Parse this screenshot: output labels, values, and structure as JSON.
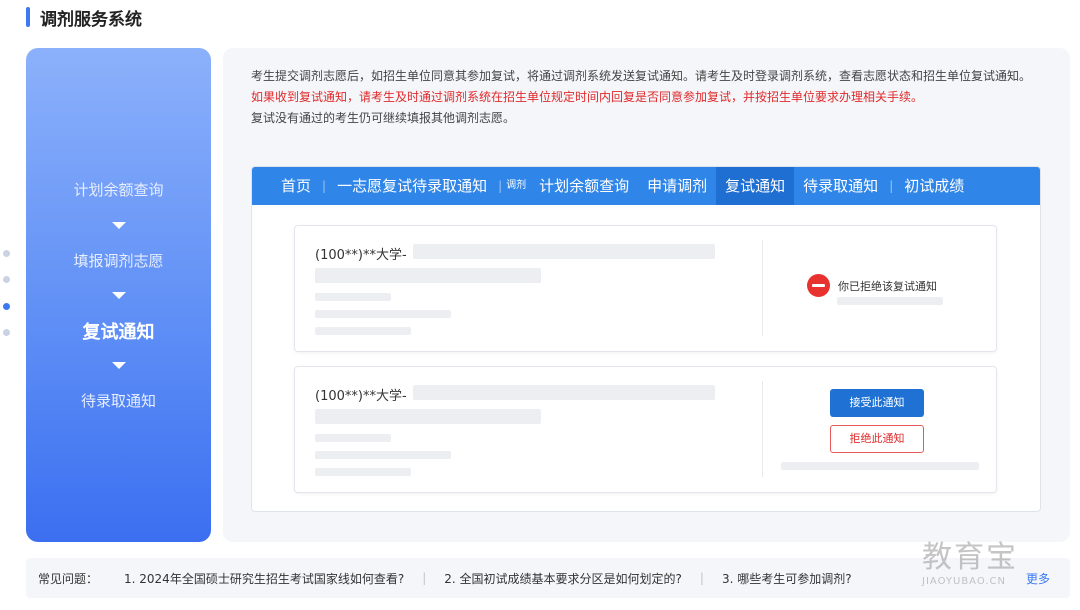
{
  "page_title": "调剂服务系统",
  "steps": [
    {
      "label": "计划余额查询",
      "active": false
    },
    {
      "label": "填报调剂志愿",
      "active": false
    },
    {
      "label": "复试通知",
      "active": true
    },
    {
      "label": "待录取通知",
      "active": false
    }
  ],
  "description": {
    "normal_1": "考生提交调剂志愿后，如招生单位同意其参加复试，将通过调剂系统发送复试通知。请考生及时登录调剂系统，查看志愿状态和招生单位复试通知。",
    "red": "如果收到复试通知，请考生及时通过调剂系统在招生单位规定时间内回复是否同意参加复试，并按招生单位要求办理相关手续。",
    "normal_2": "复试没有通过的考生仍可继续填报其他调剂志愿。"
  },
  "nav": {
    "home": "首页",
    "first_choice": "一志愿复试待录取通知",
    "adjust_small": "调剂",
    "plan_balance": "计划余额查询",
    "apply": "申请调剂",
    "retest_notice": "复试通知",
    "pending_admission": "待录取通知",
    "initial_score": "初试成绩"
  },
  "cards": [
    {
      "school": "(100**)**大学-",
      "status_text": "你已拒绝该复试通知"
    },
    {
      "school": "(100**)**大学-",
      "accept_label": "接受此通知",
      "reject_label": "拒绝此通知"
    }
  ],
  "faq": {
    "label": "常见问题：",
    "items": [
      "1. 2024年全国硕士研究生招生考试国家线如何查看?",
      "2. 全国初试成绩基本要求分区是如何划定的?",
      "3. 哪些考生可参加调剂?"
    ],
    "more": "更多"
  },
  "watermark": {
    "text": "教育宝",
    "url": "JIAOYUBAO.CN"
  },
  "colors": {
    "accent": "#3d7af0",
    "nav_bg": "#2f86e8",
    "nav_active": "#1e6fd1",
    "alert_red": "#e02b2b",
    "button_blue": "#1f72d3"
  }
}
